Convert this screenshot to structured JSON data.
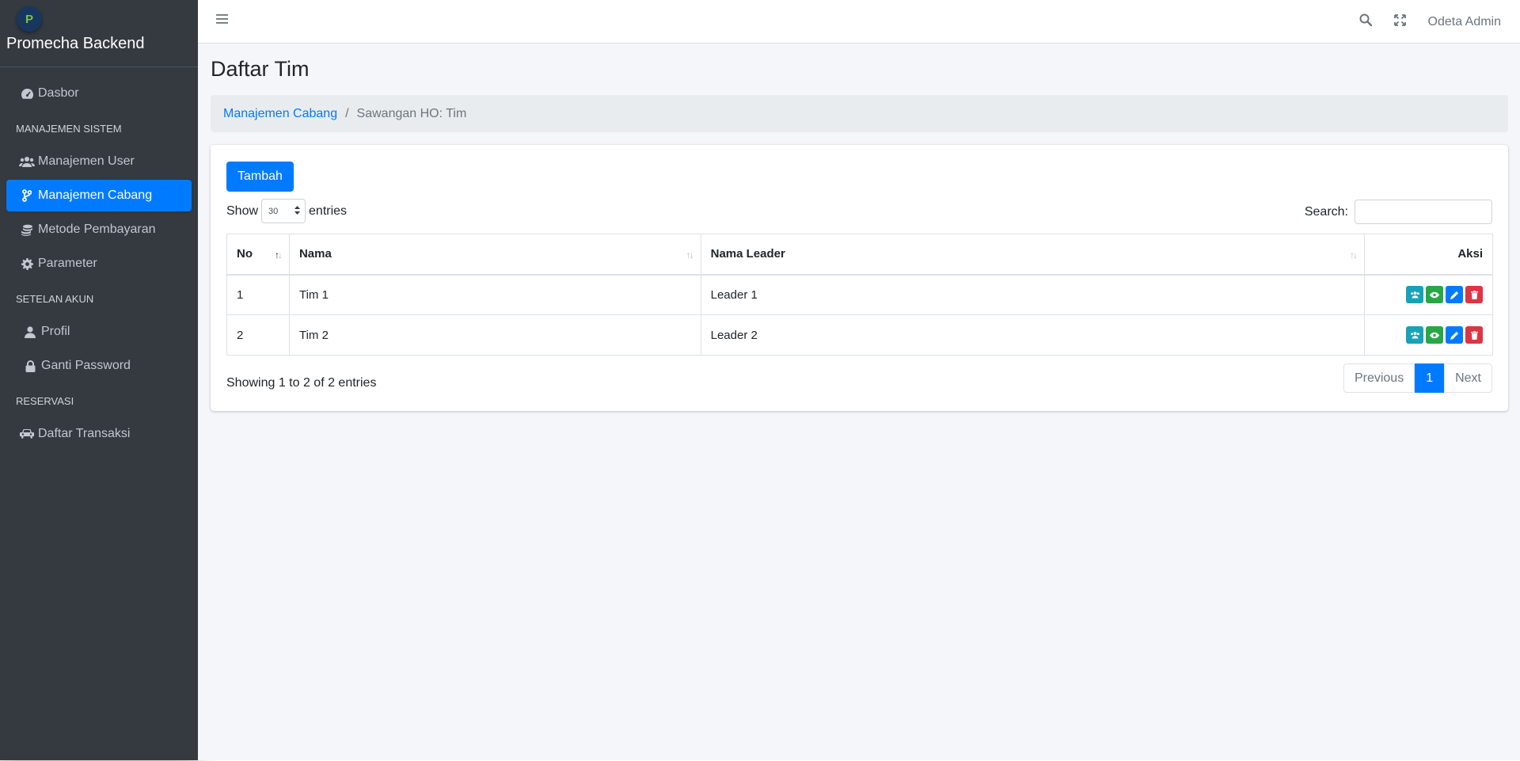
{
  "brand": {
    "name_bold": "Promecha",
    "name_light": "Backend",
    "logo_text": "P"
  },
  "sidebar": {
    "dashboard": "Dasbor",
    "section_system": "MANAJEMEN SISTEM",
    "user_mgmt": "Manajemen User",
    "branch_mgmt": "Manajemen Cabang",
    "payment": "Metode Pembayaran",
    "parameter": "Parameter",
    "section_account": "SETELAN AKUN",
    "profile": "Profil",
    "password": "Ganti Password",
    "section_reservation": "RESERVASI",
    "transactions": "Daftar Transaksi"
  },
  "topbar": {
    "user": "Odeta Admin"
  },
  "page": {
    "title": "Daftar Tim"
  },
  "breadcrumb": {
    "link": "Manajemen Cabang",
    "current": "Sawangan HO: Tim"
  },
  "toolbar": {
    "add_label": "Tambah",
    "show_label": "Show",
    "entries_value": "30",
    "entries_label": "entries",
    "search_label": "Search:"
  },
  "table": {
    "headers": {
      "no": "No",
      "nama": "Nama",
      "leader": "Nama Leader",
      "aksi": "Aksi"
    },
    "rows": [
      {
        "no": "1",
        "nama": "Tim 1",
        "leader": "Leader 1"
      },
      {
        "no": "2",
        "nama": "Tim 2",
        "leader": "Leader 2"
      }
    ]
  },
  "footer": {
    "info": "Showing 1 to 2 of 2 entries",
    "prev": "Previous",
    "page": "1",
    "next": "Next"
  },
  "colors": {
    "primary": "#007bff",
    "info": "#17a2b8",
    "success": "#28a745",
    "danger": "#dc3545",
    "sidebar": "#343a40"
  }
}
